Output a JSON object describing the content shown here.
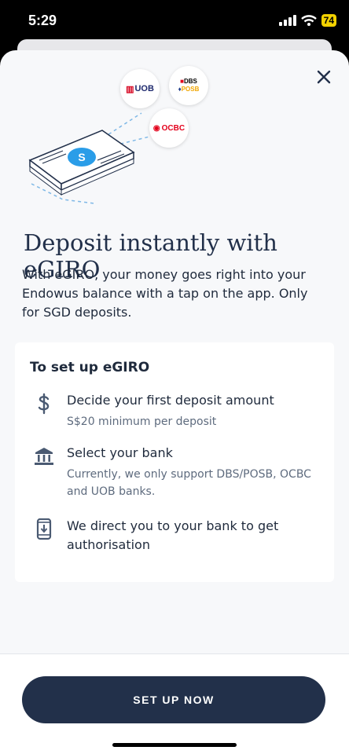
{
  "status_bar": {
    "time": "5:29",
    "battery": "74"
  },
  "illustration": {
    "banks": {
      "uob": "UOB",
      "dbs": "DBS",
      "posb": "POSB",
      "ocbc": "OCBC"
    },
    "currency_symbol": "S"
  },
  "title": "Deposit instantly with eGIRO",
  "subtitle": "With eGIRO, your money goes right into your Endowus balance with a tap on the app. Only for SGD deposits.",
  "steps": {
    "heading": "To set up eGIRO",
    "items": [
      {
        "icon": "dollar-icon",
        "title": "Decide your first deposit amount",
        "desc": "S$20 minimum per deposit"
      },
      {
        "icon": "bank-icon",
        "title": "Select your bank",
        "desc": "Currently, we only support DBS/POSB, OCBC and UOB banks."
      },
      {
        "icon": "mobile-download-icon",
        "title": "We direct you to your bank to get authorisation",
        "desc": ""
      }
    ]
  },
  "cta": {
    "label": "SET UP NOW"
  },
  "colors": {
    "primary": "#22304a",
    "background": "#f7f8fa",
    "accent": "#2a9de8"
  }
}
